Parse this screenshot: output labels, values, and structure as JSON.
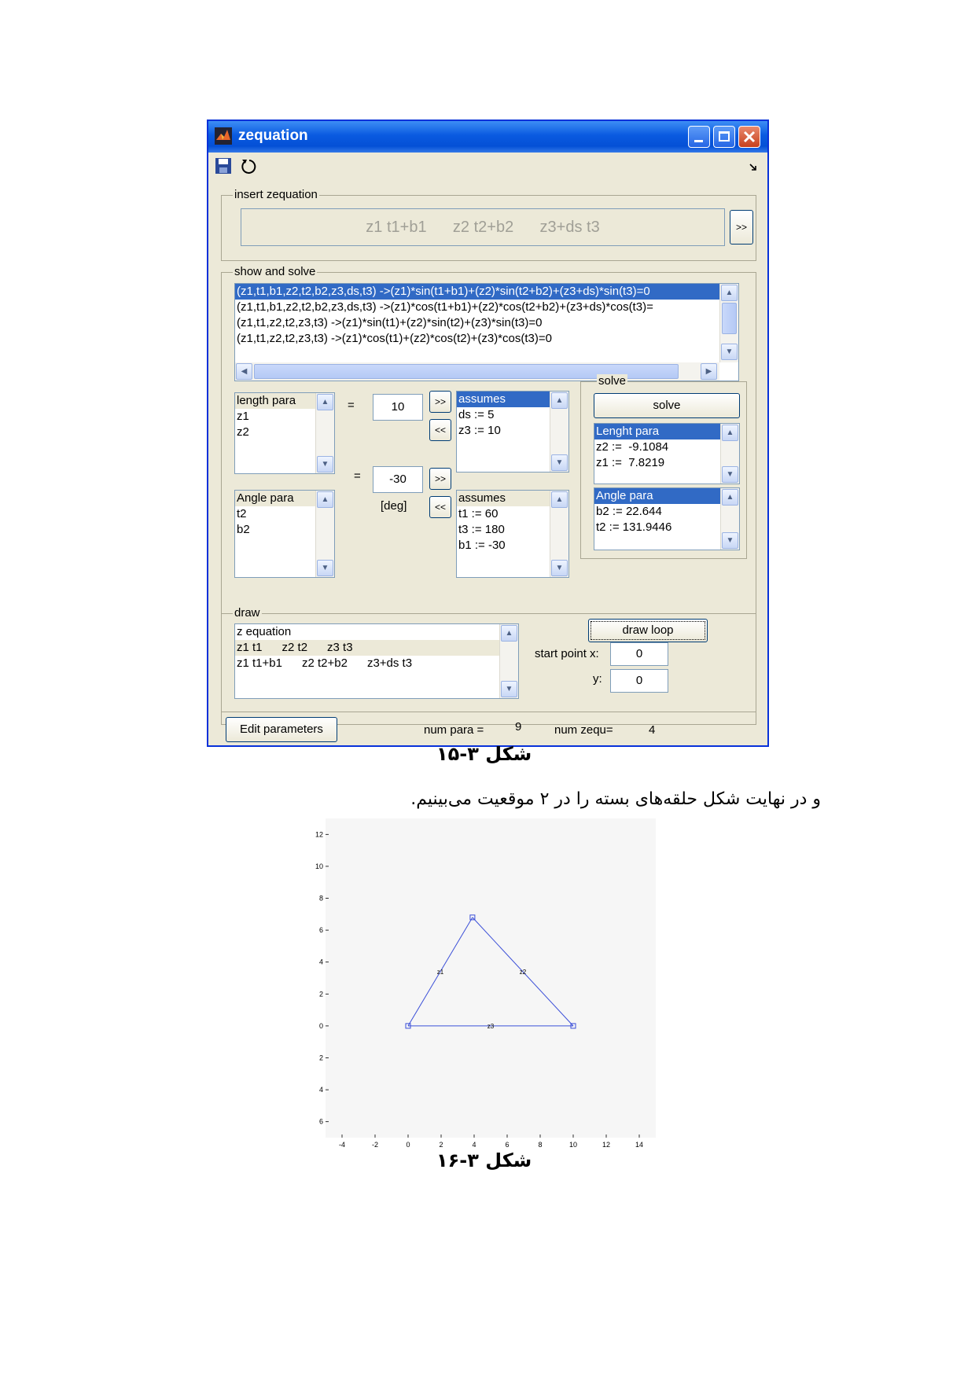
{
  "window": {
    "title": "zequation"
  },
  "insert_panel": {
    "title": "insert zequation",
    "equation_text": "z1 t1+b1      z2 t2+b2      z3+ds t3",
    "go_button": ">>"
  },
  "show_panel": {
    "title": "show and solve",
    "equations": [
      "(z1,t1,b1,z2,t2,b2,z3,ds,t3) ->(z1)*sin(t1+b1)+(z2)*sin(t2+b2)+(z3+ds)*sin(t3)=0",
      "(z1,t1,b1,z2,t2,b2,z3,ds,t3) ->(z1)*cos(t1+b1)+(z2)*cos(t2+b2)+(z3+ds)*cos(t3)=",
      "(z1,t1,z2,t2,z3,t3) ->(z1)*sin(t1)+(z2)*sin(t2)+(z3)*sin(t3)=0",
      "(z1,t1,z2,t2,z3,t3) ->(z1)*cos(t1)+(z2)*cos(t2)+(z3)*cos(t3)=0"
    ],
    "length_list": [
      "length para",
      "z1",
      "z2"
    ],
    "length_eq": "=",
    "length_value": "10",
    "length_assumes": [
      "assumes",
      "ds := 5",
      "z3 := 10"
    ],
    "angle_list": [
      "Angle para",
      "t2",
      "b2"
    ],
    "angle_eq": "=",
    "angle_value": "-30",
    "angle_unit": "[deg]",
    "angle_assumes": [
      "assumes",
      "t1 := 60",
      "t3 := 180",
      "b1 := -30"
    ],
    "add_button": ">>",
    "remove_button": "<<"
  },
  "solve_panel": {
    "title": "solve",
    "solve_button": "solve",
    "length_results": [
      "Lenght para",
      "z2 :=  -9.1084",
      "z1 :=  7.8219"
    ],
    "angle_results": [
      "Angle para",
      "b2 := 22.644",
      "t2 := 131.9446"
    ]
  },
  "draw_panel": {
    "title": "draw",
    "list": [
      "z equation",
      "z1 t1      z2 t2      z3 t3",
      "z1 t1+b1      z2 t2+b2      z3+ds t3"
    ],
    "draw_button": "draw loop",
    "start_x_label": "start point x:",
    "start_x": "0",
    "y_label": "y:",
    "start_y": "0"
  },
  "footer": {
    "edit_button": "Edit parameters",
    "num_para_label": "num para =",
    "num_para": "9",
    "num_zequ_label": "num zequ=",
    "num_zequ": "4"
  },
  "caption1": "شکل ۳-۱۵",
  "persian_text": "و در نهایت شکل حلقه‌های بسته را در ۲ موقعیت می‌بینیم.",
  "caption2": "شکل ۳-۱۶",
  "chart_data": {
    "type": "line",
    "x_ticks": [
      "-4",
      "-2",
      "0",
      "2",
      "4",
      "6",
      "8",
      "10",
      "12",
      "14"
    ],
    "y_ticks": [
      "12",
      "10",
      "8",
      "6",
      "4",
      "2",
      "0",
      "2",
      "4",
      "6"
    ],
    "xlim": [
      -5,
      15
    ],
    "ylim": [
      -7,
      13
    ],
    "points": [
      [
        0,
        0
      ],
      [
        3.9,
        6.8
      ],
      [
        10,
        0
      ]
    ],
    "segment_labels": [
      "z1",
      "z2",
      "z3"
    ],
    "line_color": "#3b4fd8"
  }
}
